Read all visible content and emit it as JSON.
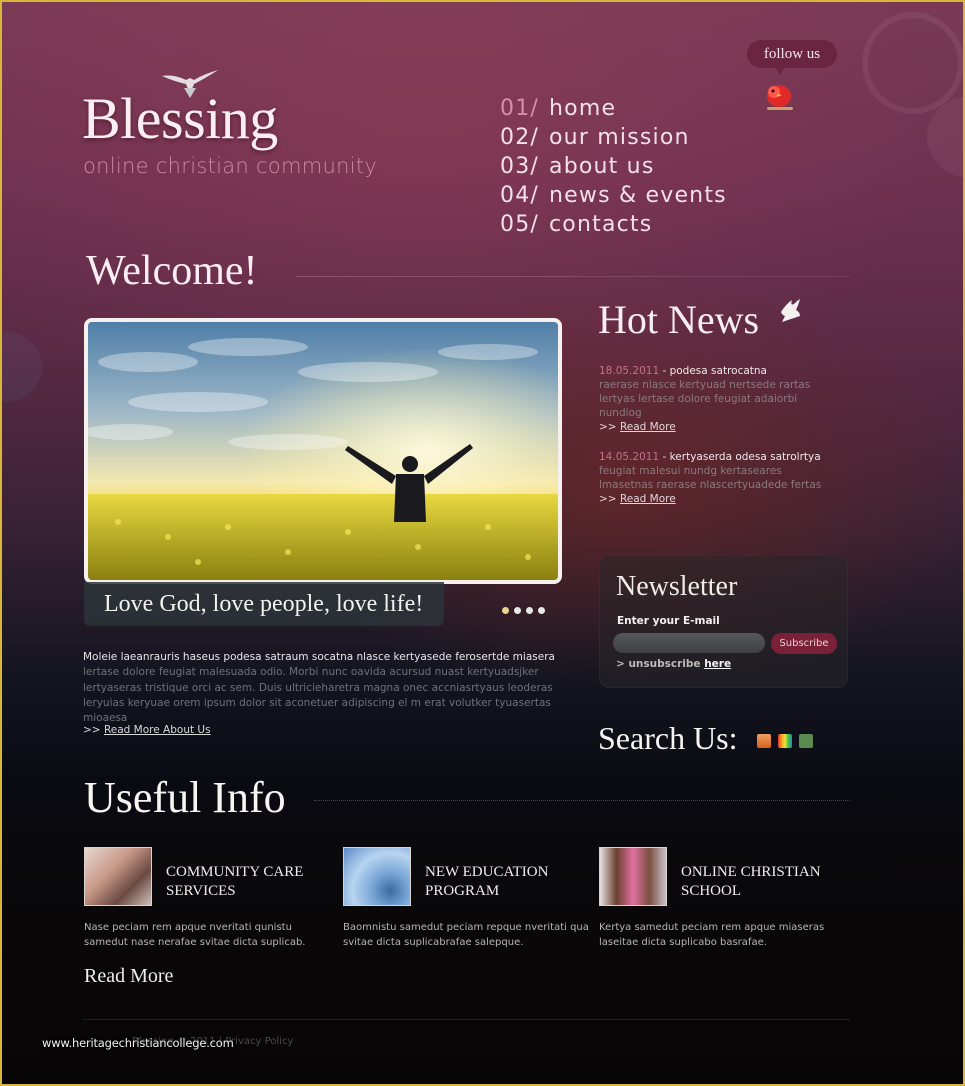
{
  "header": {
    "logo_title": "Blessing",
    "logo_subtitle": "online christian community",
    "follow_label": "follow us"
  },
  "nav": {
    "items": [
      {
        "num": "01/",
        "label": "home",
        "active": true
      },
      {
        "num": "02/",
        "label": "our mission",
        "active": false
      },
      {
        "num": "03/",
        "label": "about us",
        "active": false
      },
      {
        "num": "04/",
        "label": "news & events",
        "active": false
      },
      {
        "num": "05/",
        "label": "contacts",
        "active": false
      }
    ]
  },
  "welcome": {
    "title": "Welcome!",
    "slide_caption": "Love God, love people, love life!",
    "slide_count": 4,
    "active_slide": 1,
    "intro_lead": "Moleie laeanrauris haseus podesa satraum socatna nlasce kertyasede ferosertde miasera",
    "intro_body": "lertase dolore feugiat malesuada odio. Morbi nunc oavida acursud nuast kertyuadsjker lertyaseras tristique orci ac sem. Duis ultricieharetra magna onec accniasrtyaus leoderas leryuias keryuae orem ipsum dolor sit aconetuer adipiscing el m erat volutker tyuasertas mioaesa",
    "more_prefix": ">>",
    "more_label": "Read More About Us"
  },
  "hot_news": {
    "title": "Hot News",
    "items": [
      {
        "date": "18.05.2011",
        "separator": " - ",
        "headline": "podesa satrocatna",
        "body": "raerase nlasce kertyuad nertsede rartas lertyas lertase dolore feugiat adaiorbi nundiog",
        "more_prefix": ">>",
        "more_label": "Read More"
      },
      {
        "date": "14.05.2011",
        "separator": " - ",
        "headline": "kertyaserda odesa satrolrtya",
        "body": "feugiat malesui nundg kertaseares lmasetnas raerase nlascertyuadede fertas",
        "more_prefix": ">>",
        "more_label": "Read More"
      }
    ]
  },
  "newsletter": {
    "title": "Newsletter",
    "email_label": "Enter your E-mail",
    "email_value": "",
    "email_placeholder": "",
    "subscribe_label": "Subscribe",
    "unsubscribe_prefix": "> unsubscribe",
    "unsubscribe_link": "here"
  },
  "search_us": {
    "title": "Search Us:",
    "icons": [
      "orange-social-icon",
      "rainbow-social-icon",
      "evernote-icon"
    ]
  },
  "useful_info": {
    "title": "Useful Info",
    "items": [
      {
        "title_line1": "COMMUNITY CARE",
        "title_line2": "SERVICES",
        "text": "Nase peciam rem apque nveritati qunistu samedut nase nerafae svitae dicta suplicab."
      },
      {
        "title_line1": "NEW EDUCATION",
        "title_line2": "PROGRAM",
        "text": "Baomnistu samedut peciam repque nveritati qua svitae dicta suplicabrafae salepque."
      },
      {
        "title_line1": "ONLINE CHRISTIAN",
        "title_line2": "SCHOOL",
        "text": "Kertya samedut peciam rem apque miaseras laseitae dicta suplicabo basrafae."
      }
    ],
    "read_more": "Read More"
  },
  "footer": {
    "text": "Blessing © 2011 | Privacy Policy",
    "watermark": "www.heritagechristiancollege.com"
  },
  "colors": {
    "frame_border": "#d8b63a",
    "nav_active_num": "#d98da6",
    "news_date": "#c4708e",
    "subscribe_button": "#7a2038",
    "follow_bubble": "#6a2540"
  }
}
